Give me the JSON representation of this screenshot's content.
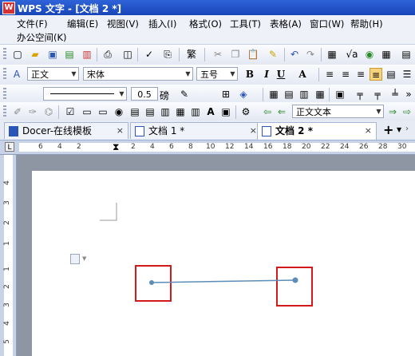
{
  "app": {
    "title": "WPS 文字 - [文档 2 *]",
    "logo_letter": "W"
  },
  "menu": {
    "items": [
      "文件(F)",
      "编辑(E)",
      "视图(V)",
      "插入(I)",
      "格式(O)",
      "工具(T)",
      "表格(A)",
      "窗口(W)",
      "帮助(H)"
    ],
    "second_row": "办公空间(K)"
  },
  "format_toolbar": {
    "style": "正文",
    "font": "宋体",
    "size": "五号",
    "bold": "B",
    "italic": "I",
    "underline": "U",
    "text_effect": "A"
  },
  "draw_toolbar": {
    "line_width_value": "0.5",
    "line_width_unit": "磅"
  },
  "edit_toolbar": {
    "text_style_combo": "正文文本"
  },
  "tabs": [
    {
      "label": "Docer-在线模板",
      "close": "×"
    },
    {
      "label": "文档 1 *",
      "close": "×"
    },
    {
      "label": "文档 2 *",
      "close": "×"
    }
  ],
  "tab_add": "+",
  "ruler": {
    "corner": "L",
    "h_numbers": [
      "6",
      "4",
      "2",
      "2",
      "4",
      "6",
      "8",
      "10",
      "12",
      "14",
      "16",
      "18",
      "20",
      "22",
      "24",
      "26",
      "28",
      "30"
    ],
    "v_numbers": [
      "4",
      "3",
      "2",
      "1",
      "1",
      "2",
      "3",
      "4",
      "5"
    ]
  },
  "colors": {
    "highlight_box": "#d11a1a",
    "line": "#5b8db8",
    "title_bar": "#1f4fc2"
  }
}
